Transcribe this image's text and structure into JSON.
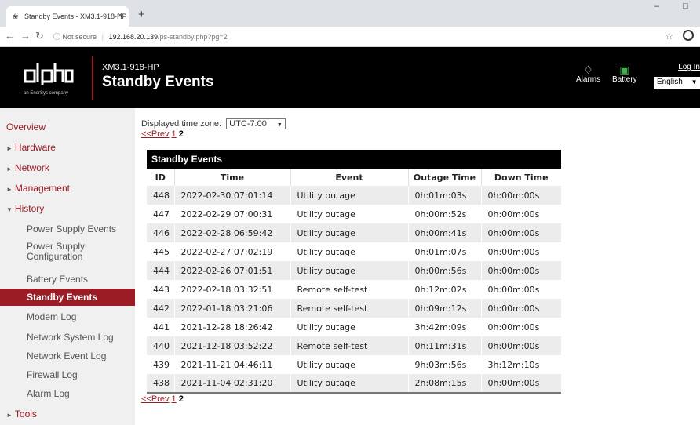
{
  "browser": {
    "tab_title": "Standby Events - XM3.1-918-HP",
    "tab_close": "×",
    "new_tab": "+",
    "not_secure": "Not secure",
    "url_host": "192.168.20.139",
    "url_path": "/ps-standby.php?pg=2"
  },
  "header": {
    "logo_text": "alpha",
    "logo_tagline": "an EnerSys company",
    "model": "XM3.1-918-HP",
    "title": "Standby Events",
    "alarms_label": "Alarms",
    "battery_label": "Battery",
    "login_label": "Log In",
    "language": "English"
  },
  "sidebar": {
    "items": [
      {
        "label": "Overview"
      },
      {
        "label": "Hardware"
      },
      {
        "label": "Network"
      },
      {
        "label": "Management"
      },
      {
        "label": "History"
      },
      {
        "label": "Power Supply Events"
      },
      {
        "label": "Power Supply Configuration"
      },
      {
        "label": "Battery Events"
      },
      {
        "label": "Standby Events"
      },
      {
        "label": "Modem Log"
      },
      {
        "label": "Network System Log"
      },
      {
        "label": "Network Event Log"
      },
      {
        "label": "Firewall Log"
      },
      {
        "label": "Alarm Log"
      },
      {
        "label": "Tools"
      }
    ]
  },
  "main": {
    "tz_label": "Displayed time zone:",
    "tz_value": "UTC-7:00",
    "prev_link": "<<Prev",
    "page_1": "1",
    "page_2": "2",
    "table_title": "Standby Events",
    "columns": [
      "ID",
      "Time",
      "Event",
      "Outage Time",
      "Down Time"
    ],
    "rows": [
      [
        "448",
        "2022-02-30 07:01:14",
        "Utility outage",
        "0h:01m:03s",
        "0h:00m:00s"
      ],
      [
        "447",
        "2022-02-29 07:00:31",
        "Utility outage",
        "0h:00m:52s",
        "0h:00m:00s"
      ],
      [
        "446",
        "2022-02-28 06:59:42",
        "Utility outage",
        "0h:00m:41s",
        "0h:00m:00s"
      ],
      [
        "445",
        "2022-02-27 07:02:19",
        "Utility outage",
        "0h:01m:07s",
        "0h:00m:00s"
      ],
      [
        "444",
        "2022-02-26 07:01:51",
        "Utility outage",
        "0h:00m:56s",
        "0h:00m:00s"
      ],
      [
        "443",
        "2022-02-18 03:32:51",
        "Remote self-test",
        "0h:12m:02s",
        "0h:00m:00s"
      ],
      [
        "442",
        "2022-01-18 03:21:06",
        "Remote self-test",
        "0h:09m:12s",
        "0h:00m:00s"
      ],
      [
        "441",
        "2021-12-28 18:26:42",
        "Utility outage",
        "3h:42m:09s",
        "0h:00m:00s"
      ],
      [
        "440",
        "2021-12-18 03:52:22",
        "Remote self-test",
        "0h:11m:31s",
        "0h:00m:00s"
      ],
      [
        "439",
        "2021-11-21 04:46:11",
        "Utility outage",
        "9h:03m:56s",
        "3h:12m:10s"
      ],
      [
        "438",
        "2021-11-04 02:31:20",
        "Utility outage",
        "2h:08m:15s",
        "0h:00m:00s"
      ]
    ]
  },
  "colors": {
    "brand": "#9b1c25",
    "header_bg": "#000000",
    "sidebar_bg": "#f0f0f0"
  }
}
